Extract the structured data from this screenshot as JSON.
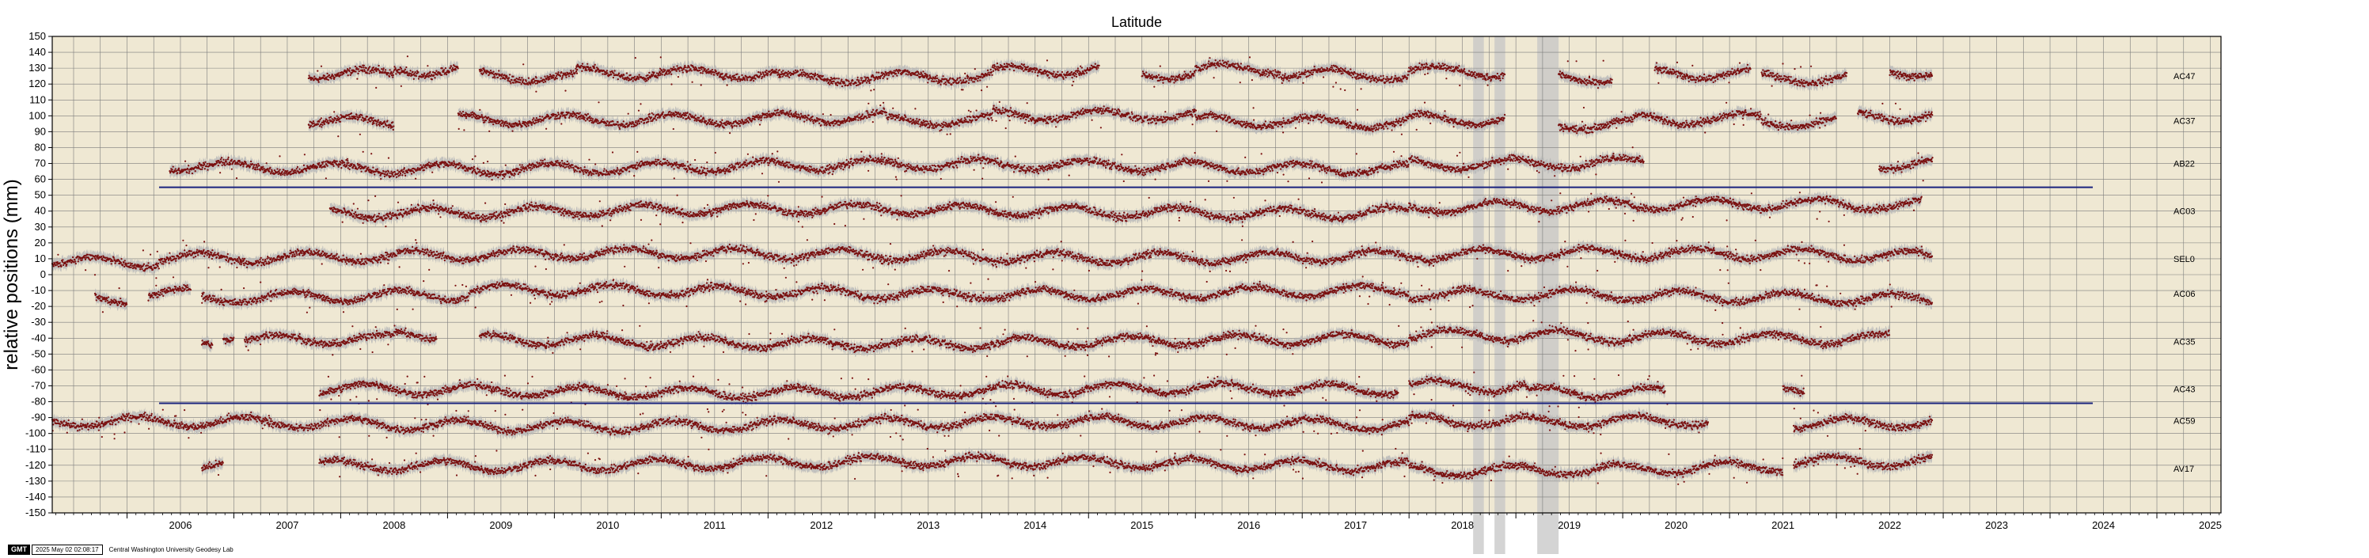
{
  "chart_data": {
    "type": "scatter",
    "title": "Latitude",
    "xlabel": "",
    "ylabel": "relative positions (mm)",
    "xlim": [
      2005.3,
      2025.6
    ],
    "ylim": [
      -150,
      150
    ],
    "x_ticks": [
      "2006",
      "2007",
      "2008",
      "2009",
      "2010",
      "2011",
      "2012",
      "2013",
      "2014",
      "2015",
      "2016",
      "2017",
      "2018",
      "2019",
      "2020",
      "2021",
      "2022",
      "2023",
      "2024",
      "2025"
    ],
    "y_ticks": [
      150,
      140,
      130,
      120,
      110,
      100,
      90,
      80,
      70,
      60,
      50,
      40,
      30,
      20,
      10,
      0,
      -10,
      -20,
      -30,
      -40,
      -50,
      -60,
      -70,
      -80,
      -90,
      -100,
      -110,
      -120,
      -130,
      -140,
      -150
    ],
    "grid": true,
    "marker_color": "#7a1010",
    "error_color": "#b9b9b9",
    "background_color": "#efe8d3",
    "reference_lines": [
      {
        "y": 55,
        "x_start": 2006.3,
        "x_end": 2024.4,
        "color": "#1a237e"
      },
      {
        "y": -81,
        "x_start": 2006.3,
        "x_end": 2024.4,
        "color": "#1a237e"
      }
    ],
    "series": [
      {
        "name": "AC47",
        "offset": 125,
        "segments": [
          [
            2007.7,
            2008.5
          ],
          [
            2008.5,
            2009.1
          ],
          [
            2009.3,
            2010.2
          ],
          [
            2010.2,
            2012.1
          ],
          [
            2012.1,
            2014.1
          ],
          [
            2014.1,
            2015.1
          ],
          [
            2015.5,
            2016.0
          ],
          [
            2016.0,
            2016.8
          ],
          [
            2016.8,
            2018.0
          ],
          [
            2018.0,
            2018.9
          ],
          [
            2019.4,
            2019.9
          ],
          [
            2020.3,
            2021.2
          ],
          [
            2021.3,
            2022.1
          ],
          [
            2022.5,
            2022.9
          ]
        ]
      },
      {
        "name": "AC37",
        "offset": 97,
        "segments": [
          [
            2007.7,
            2008.5
          ],
          [
            2009.1,
            2013.1
          ],
          [
            2013.1,
            2014.1
          ],
          [
            2014.1,
            2016.0
          ],
          [
            2016.0,
            2018.0
          ],
          [
            2018.0,
            2018.9
          ],
          [
            2019.4,
            2020.1
          ],
          [
            2020.1,
            2021.3
          ],
          [
            2021.3,
            2022.0
          ],
          [
            2022.2,
            2022.9
          ]
        ]
      },
      {
        "name": "AB22",
        "offset": 70,
        "segments": [
          [
            2006.4,
            2018.0
          ],
          [
            2018.0,
            2020.2
          ],
          [
            2022.4,
            2022.9
          ]
        ]
      },
      {
        "name": "AC03",
        "offset": 40,
        "segments": [
          [
            2007.9,
            2018.0
          ],
          [
            2018.0,
            2022.8
          ]
        ]
      },
      {
        "name": "SEL0",
        "offset": 10,
        "segments": [
          [
            2005.3,
            2006.3
          ],
          [
            2006.3,
            2022.9
          ]
        ]
      },
      {
        "name": "AC06",
        "offset": -12,
        "segments": [
          [
            2005.7,
            2006.0
          ],
          [
            2006.2,
            2006.6
          ],
          [
            2006.7,
            2009.2
          ],
          [
            2009.2,
            2018.0
          ],
          [
            2018.0,
            2022.9
          ]
        ]
      },
      {
        "name": "AC35",
        "offset": -42,
        "segments": [
          [
            2006.7,
            2006.8
          ],
          [
            2006.9,
            2007.0
          ],
          [
            2007.1,
            2008.5
          ],
          [
            2008.5,
            2008.9
          ],
          [
            2009.3,
            2018.0
          ],
          [
            2018.0,
            2022.5
          ]
        ]
      },
      {
        "name": "AC43",
        "offset": -72,
        "segments": [
          [
            2007.8,
            2017.9
          ],
          [
            2018.0,
            2019.1
          ],
          [
            2019.1,
            2020.4
          ],
          [
            2021.5,
            2021.7
          ]
        ]
      },
      {
        "name": "AC59",
        "offset": -92,
        "segments": [
          [
            2005.3,
            2018.0
          ],
          [
            2018.0,
            2020.8
          ],
          [
            2021.6,
            2022.9
          ]
        ]
      },
      {
        "name": "AV17",
        "offset": -122,
        "segments": [
          [
            2006.7,
            2006.9
          ],
          [
            2007.8,
            2018.0
          ],
          [
            2018.0,
            2021.5
          ],
          [
            2021.6,
            2022.9
          ]
        ]
      }
    ],
    "outage_bands": [
      [
        2018.6,
        2018.7
      ],
      [
        2018.8,
        2018.9
      ],
      [
        2019.2,
        2019.4
      ]
    ]
  },
  "footer": {
    "logo": "GMT",
    "timestamp": "2025 May 02 02:08:17",
    "credit": "Central Washington University Geodesy Lab"
  }
}
